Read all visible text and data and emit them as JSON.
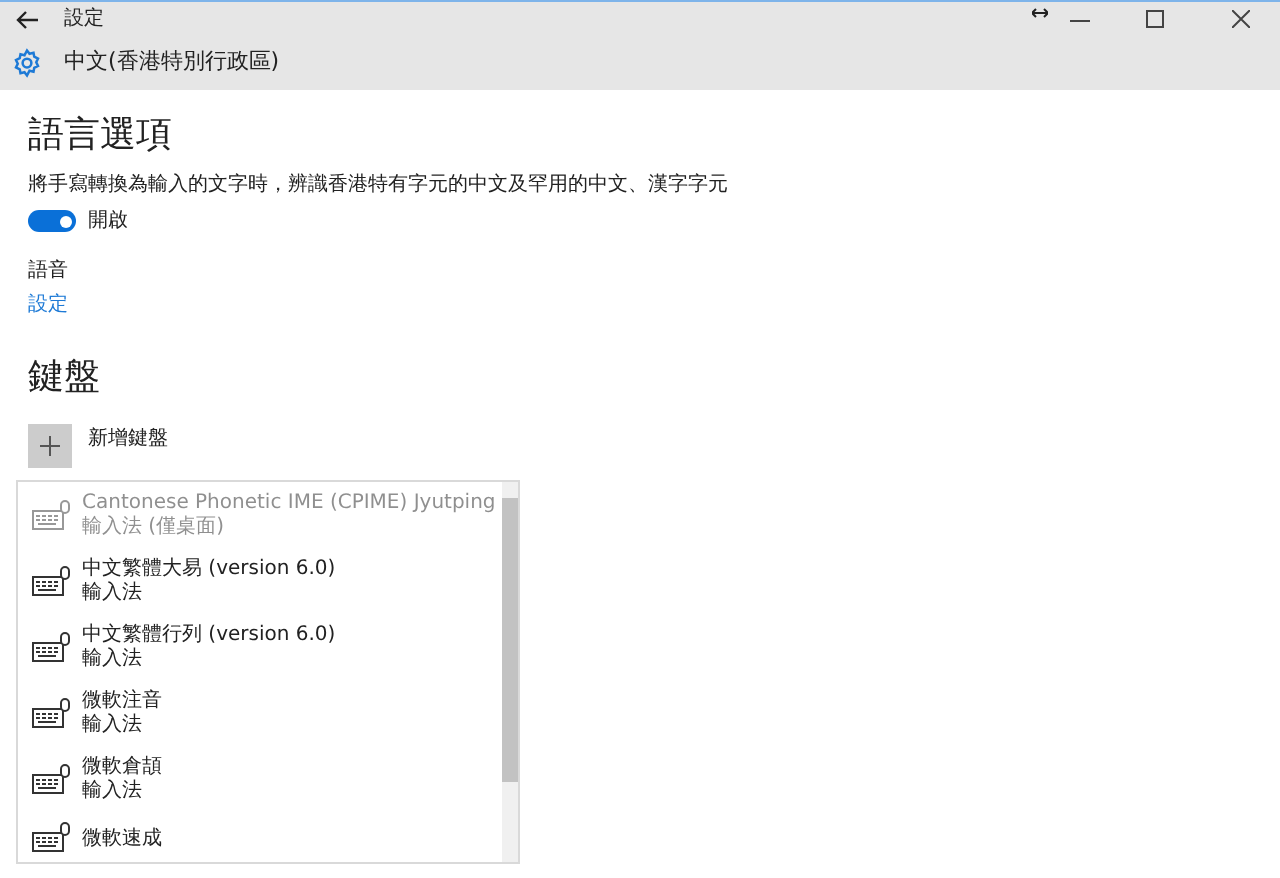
{
  "window": {
    "title": "設定"
  },
  "header": {
    "title": "中文(香港特別行政區)"
  },
  "language_options": {
    "heading": "語言選項",
    "description": "將手寫轉換為輸入的文字時，辨識香港特有字元的中文及罕用的中文、漢字字元",
    "toggle": {
      "on": true,
      "label": "開啟"
    }
  },
  "speech": {
    "label": "語音",
    "link": "設定"
  },
  "keyboards": {
    "heading": "鍵盤",
    "add_label": "新增鍵盤",
    "items": [
      {
        "name": "Cantonese Phonetic IME (CPIME) Jyutping",
        "subtitle": "輸入法 (僅桌面)",
        "disabled": true
      },
      {
        "name": "中文繁體大易 (version 6.0)",
        "subtitle": "輸入法",
        "disabled": false
      },
      {
        "name": "中文繁體行列 (version 6.0)",
        "subtitle": "輸入法",
        "disabled": false
      },
      {
        "name": "微軟注音",
        "subtitle": "輸入法",
        "disabled": false
      },
      {
        "name": "微軟倉頡",
        "subtitle": "輸入法",
        "disabled": false
      },
      {
        "name": "微軟速成",
        "disabled": false
      }
    ]
  }
}
